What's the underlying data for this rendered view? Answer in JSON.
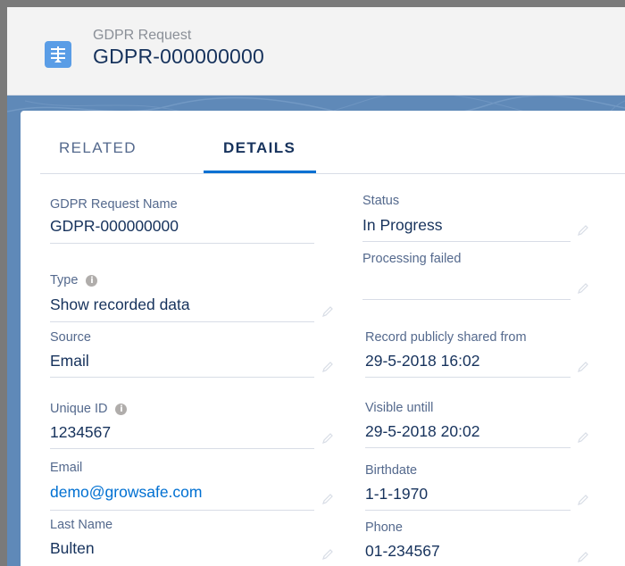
{
  "header": {
    "object_type": "GDPR Request",
    "record_title": "GDPR-000000000",
    "icon": "gdpr-request-icon",
    "icon_color": "#5a9de6"
  },
  "tabs": [
    {
      "label": "RELATED",
      "active": false
    },
    {
      "label": "DETAILS",
      "active": true
    }
  ],
  "fields_left": [
    {
      "label": "GDPR Request Name",
      "value": "GDPR-000000000"
    },
    {
      "label": "Type",
      "value": "Show recorded data",
      "info": true
    },
    {
      "label": "Source",
      "value": "Email"
    },
    {
      "label": "Unique ID",
      "value": "1234567",
      "info": true
    },
    {
      "label": "Email",
      "value": "demo@growsafe.com",
      "link": true
    },
    {
      "label": "Last Name",
      "value": "Bulten"
    }
  ],
  "fields_right": [
    {
      "label": "Status",
      "value": "In Progress"
    },
    {
      "label": "Processing failed",
      "value": ""
    },
    {
      "label": "Record publicly shared from",
      "value": "29-5-2018 16:02"
    },
    {
      "label": "Visible untill",
      "value": "29-5-2018 20:02"
    },
    {
      "label": "Birthdate",
      "value": "1-1-1970"
    },
    {
      "label": "Phone",
      "value": "01-234567"
    }
  ],
  "colors": {
    "accent": "#0070d2",
    "text_primary": "#16325c",
    "text_label": "#54698d",
    "header_bg": "#f3f3f3",
    "backdrop": "#5f89b8"
  }
}
